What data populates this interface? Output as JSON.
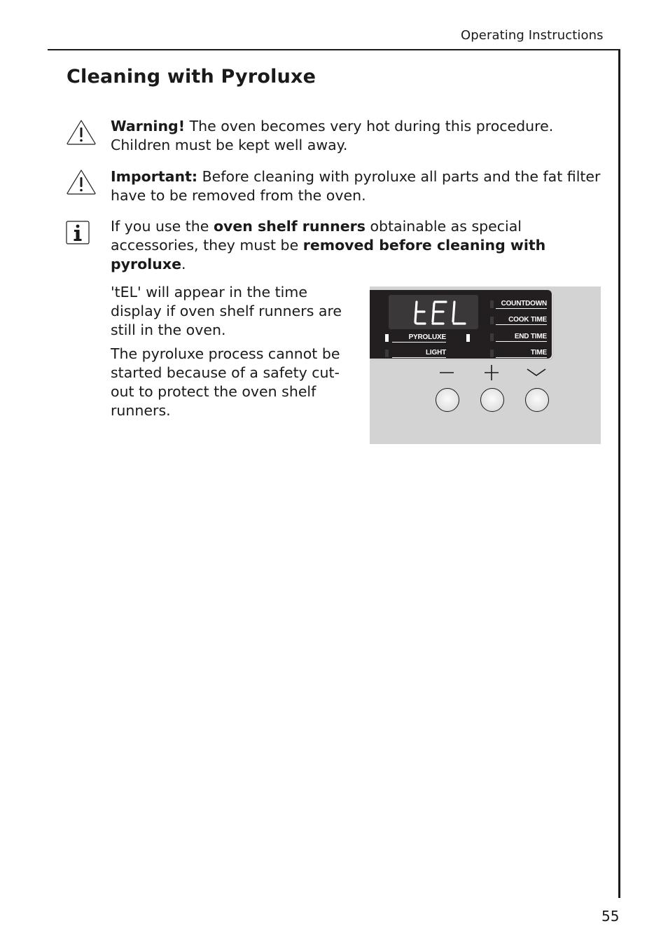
{
  "header": {
    "section": "Operating Instructions"
  },
  "title": "Cleaning with Pyroluxe",
  "notes": [
    {
      "icon": "warning-icon",
      "bold": "Warning!",
      "text": " The oven becomes very hot during this procedure. Children must be kept well away."
    },
    {
      "icon": "warning-icon",
      "bold": "Important:",
      "text": " Before cleaning with pyroluxe all parts and the fat filter have to be removed from the oven."
    },
    {
      "icon": "info-icon",
      "text_a": "If you use the ",
      "bold_a": "oven shelf runners",
      "text_b": " obtainable as special accessories, they must be ",
      "bold_b": "removed before cleaning with pyroluxe",
      "text_c": "."
    }
  ],
  "paragraphs": [
    "'tEL' will appear in the time display if oven shelf runners are still in the oven.",
    "The pyroluxe process cannot be started because of a safety cut-out to protect the oven shelf runners."
  ],
  "control_panel": {
    "display_text": "tEL",
    "left_labels": [
      {
        "label": "PYROLUXE",
        "led_on": true
      },
      {
        "label": "LIGHT",
        "led_on": false
      }
    ],
    "right_labels": [
      {
        "label": "COUNTDOWN",
        "led_on": false
      },
      {
        "label": "COOK TIME",
        "led_on": false
      },
      {
        "label": "END TIME",
        "led_on": false
      },
      {
        "label": "TIME",
        "led_on": false
      }
    ],
    "buttons": [
      {
        "symbol": "minus-icon"
      },
      {
        "symbol": "plus-icon"
      },
      {
        "symbol": "chevron-down-icon"
      }
    ]
  },
  "footer": {
    "page_number": "55"
  }
}
